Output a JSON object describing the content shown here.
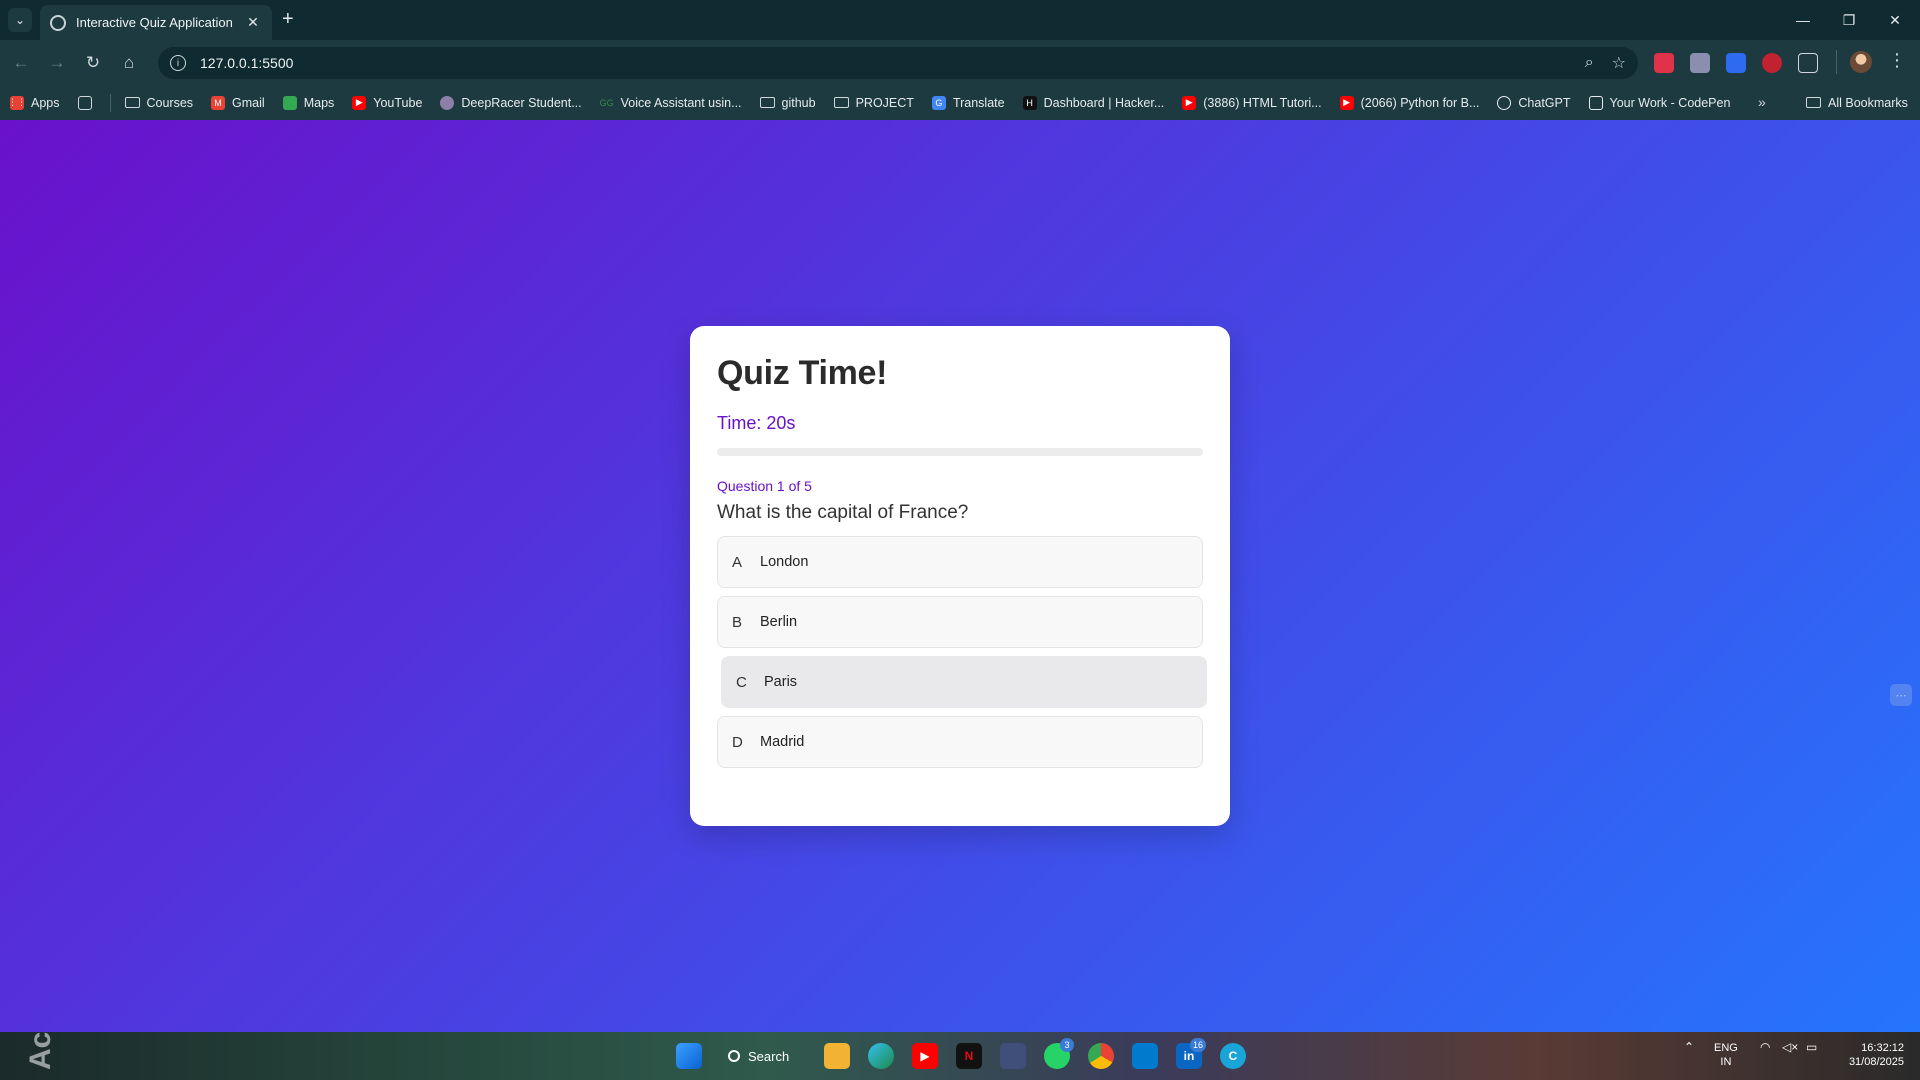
{
  "browser": {
    "tab_title": "Interactive Quiz Application",
    "tab_close": "✕",
    "new_tab": "+",
    "url": "127.0.0.1:5500",
    "window_controls": {
      "minimize": "—",
      "restore": "❐",
      "close": "✕"
    }
  },
  "bookmarks": {
    "items": [
      {
        "label": "Apps",
        "icon": "apps-grid-icon"
      },
      {
        "label": "Courses",
        "icon": "folder-icon"
      },
      {
        "label": "Gmail",
        "icon": "gmail-icon"
      },
      {
        "label": "Maps",
        "icon": "maps-icon"
      },
      {
        "label": "YouTube",
        "icon": "youtube-icon"
      },
      {
        "label": "DeepRacer Student...",
        "icon": "deepracer-icon"
      },
      {
        "label": "Voice Assistant usin...",
        "icon": "gfg-icon"
      },
      {
        "label": "github",
        "icon": "folder-icon"
      },
      {
        "label": "PROJECT",
        "icon": "folder-icon"
      },
      {
        "label": "Translate",
        "icon": "translate-icon"
      },
      {
        "label": "Dashboard | Hacker...",
        "icon": "hackerrank-icon"
      },
      {
        "label": "(3886) HTML Tutori...",
        "icon": "youtube-icon"
      },
      {
        "label": "(2066) Python for B...",
        "icon": "youtube-icon"
      },
      {
        "label": "ChatGPT",
        "icon": "chatgpt-icon"
      },
      {
        "label": "Your Work - CodePen",
        "icon": "codepen-icon"
      }
    ],
    "more": "»",
    "all_bookmarks": "All Bookmarks"
  },
  "quiz": {
    "title": "Quiz Time!",
    "timer": "Time: 20s",
    "progress_fraction": 0.0,
    "question_counter": "Question 1 of 5",
    "question": "What is the capital of France?",
    "options": [
      {
        "letter": "A",
        "text": "London"
      },
      {
        "letter": "B",
        "text": "Berlin"
      },
      {
        "letter": "C",
        "text": "Paris"
      },
      {
        "letter": "D",
        "text": "Madrid"
      }
    ],
    "hovered_option": "C"
  },
  "colors": {
    "gradient_start": "#6a11cb",
    "gradient_end": "#2575fc",
    "accent": "#6a11cb"
  },
  "taskbar": {
    "search_label": "Search",
    "whatsapp_badge": "3",
    "linkedin_badge": "16",
    "lang_line1": "ENG",
    "lang_line2": "IN",
    "time": "16:32:12",
    "date": "31/08/2025"
  }
}
